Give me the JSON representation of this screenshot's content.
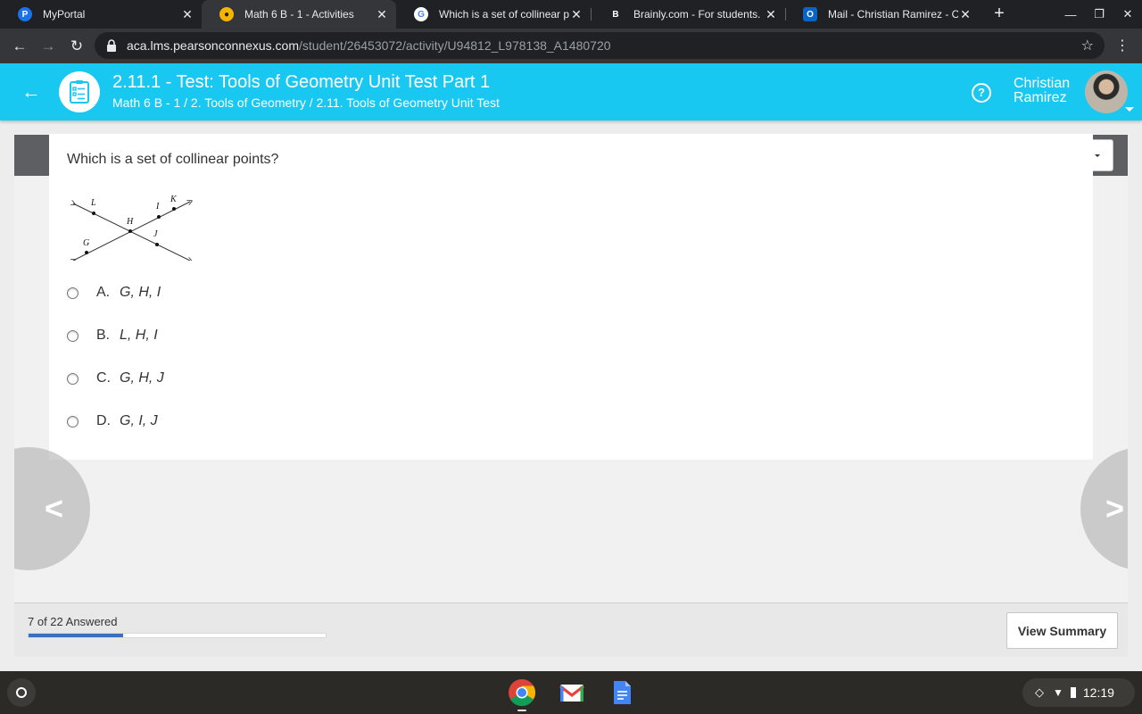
{
  "browser": {
    "tabs": [
      {
        "title": "MyPortal",
        "icon": "pearson-p-icon",
        "active": false
      },
      {
        "title": "Math 6 B - 1 - Activities",
        "icon": "pearson-globe-icon",
        "active": true
      },
      {
        "title": "Which is a set of collinear po",
        "icon": "google-g-icon",
        "active": false
      },
      {
        "title": "Brainly.com - For students. B",
        "icon": "brainly-b-icon",
        "active": false
      },
      {
        "title": "Mail - Christian Ramirez - Ou",
        "icon": "outlook-icon",
        "active": false
      }
    ],
    "url_host": "aca.lms.pearsonconnexus.com",
    "url_path": "/student/26453072/activity/U94812_L978138_A1480720"
  },
  "header": {
    "title": "2.11.1 - Test: Tools of Geometry Unit Test Part 1",
    "breadcrumb": "Math 6 B - 1 / 2. Tools of Geometry / 2.11. Tools of Geometry Unit Test",
    "user_first": "Christian",
    "user_last": "Ramirez",
    "help_symbol": "?"
  },
  "question": {
    "text": "Which is a set of collinear points?",
    "figure_points": [
      "L",
      "I",
      "K",
      "H",
      "J",
      "G"
    ],
    "options": [
      {
        "letter": "A.",
        "text": "G, H, I"
      },
      {
        "letter": "B.",
        "text": "L, H, I"
      },
      {
        "letter": "C.",
        "text": "G, H, J"
      },
      {
        "letter": "D.",
        "text": "G, I, J"
      }
    ]
  },
  "footer": {
    "progress_text": "7 of 22 Answered",
    "answered": 7,
    "total": 22,
    "summary_label": "View Summary"
  },
  "shelf": {
    "apps": [
      "chrome-icon",
      "gmail-icon",
      "docs-icon"
    ],
    "time": "12:19"
  },
  "colors": {
    "header_bg": "#18c8f0",
    "progress_fill": "#3d6fc0",
    "toolbar_bg": "#5d5f62"
  }
}
